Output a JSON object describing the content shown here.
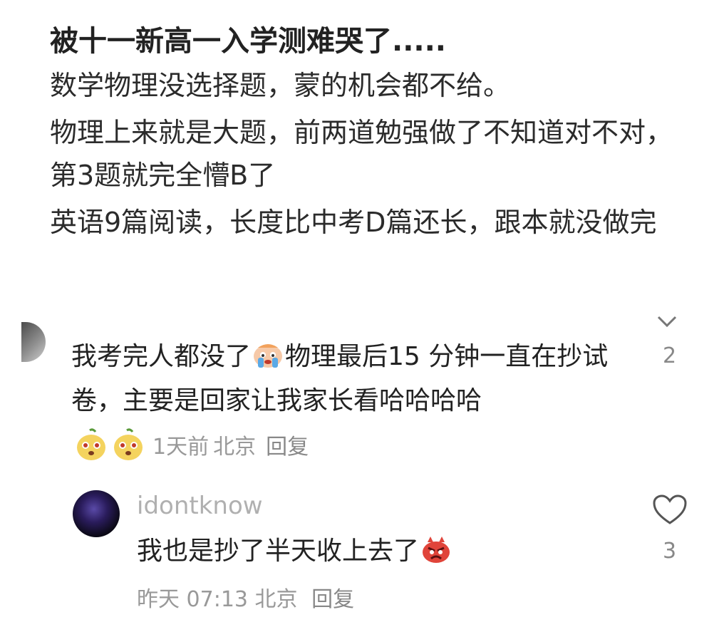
{
  "post": {
    "title": "被十一新高一入学测难哭了.....",
    "lines": [
      "数学物理没选择题，蒙的机会都不给。",
      "物理上来就是大题，前两道勉强做了不知道对不对，第3题就完全懵B了",
      "英语9篇阅读，长度比中考D篇还长，跟本就没做完"
    ]
  },
  "comment": {
    "text_part1": "我考完人都没了",
    "inline_emoji": "crying-emoji",
    "text_part2": "物理最后15 分钟一直在抄试卷，主要是回家让我家长看哈哈哈哈",
    "time": "1天前",
    "location": "北京",
    "reply_label": "回复",
    "likes": "2"
  },
  "reply": {
    "username": "idontknow",
    "text": "我也是抄了半天收上去了",
    "inline_emoji": "angry-emoji",
    "time": "昨天 07:13",
    "location": "北京",
    "reply_label": "回复",
    "likes": "3"
  },
  "icons": {
    "chevron": "chevron-down-icon",
    "heart": "heart-icon"
  },
  "colors": {
    "emoji_yellow": "#f4d35e",
    "emoji_red": "#e0443a"
  }
}
